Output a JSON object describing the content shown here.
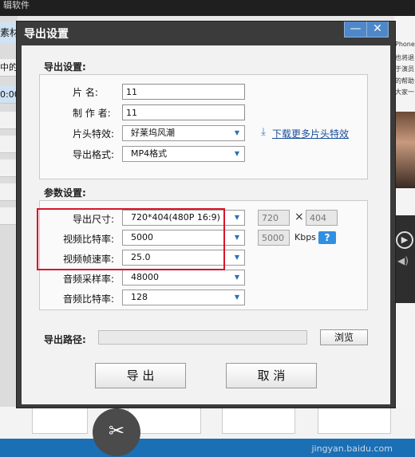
{
  "background": {
    "title": "辑软件",
    "left_tab": "素材",
    "left_rows": [
      "中的眼",
      "0:00",
      "",
      "",
      "",
      "",
      ""
    ],
    "right_texts": [
      "Phone",
      "也将退",
      "于演员",
      "的帮助",
      "大家一"
    ],
    "play_icon": "play-icon",
    "volume_icon": "volume-icon",
    "cut_icon": "scissors-icon",
    "watermark": "jingyan.baidu.com"
  },
  "dialog": {
    "title": "导出设置",
    "minimize_icon": "minimize-icon",
    "close_icon": "close-icon",
    "export_section": {
      "label": "导出设置:",
      "name_label": "片    名:",
      "name_value": "11",
      "author_label": "制 作 者:",
      "author_value": "11",
      "effect_label": "片头特效:",
      "effect_value": "好莱坞风潮",
      "format_label": "导出格式:",
      "format_value": "MP4格式",
      "download_link": "下载更多片头特效",
      "download_icon": "download-icon"
    },
    "param_section": {
      "label": "参数设置:",
      "size_label": "导出尺寸:",
      "size_value": "720*404(480P 16:9)",
      "width_value": "720",
      "times": "×",
      "height_value": "404",
      "vbitrate_label": "视频比特率:",
      "vbitrate_value": "5000",
      "vbitrate_input": "5000",
      "kbps": "Kbps",
      "help": "?",
      "framerate_label": "视频帧速率:",
      "framerate_value": "25.0",
      "samplerate_label": "音频采样率:",
      "samplerate_value": "48000",
      "abitrate_label": "音频比特率:",
      "abitrate_value": "128"
    },
    "path": {
      "label": "导出路径:",
      "value": "",
      "browse": "浏览"
    },
    "buttons": {
      "export": "导 出",
      "cancel": "取 消"
    }
  }
}
